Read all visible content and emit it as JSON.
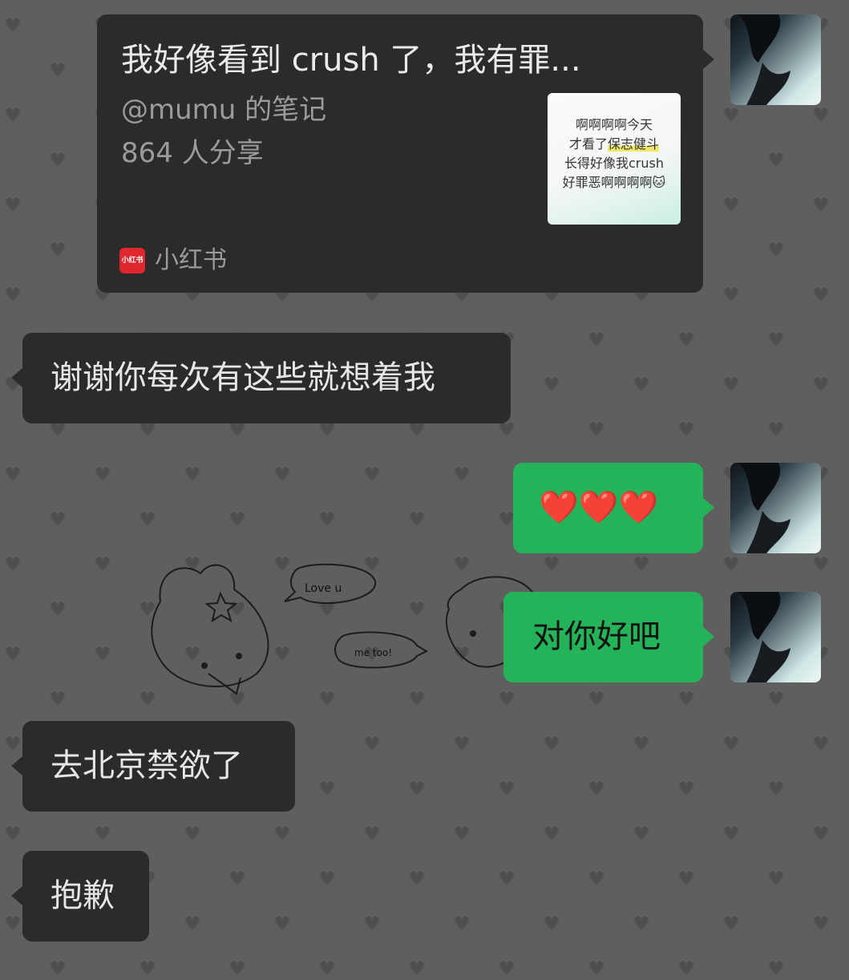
{
  "card": {
    "title": "我好像看到 crush 了，我有罪...",
    "author": "@mumu 的笔记",
    "shares": "864 人分享",
    "thumb_lines": [
      "啊啊啊啊今天",
      "才看了",
      "保志健斗",
      "长得好像我crush",
      "好罪恶啊啊啊啊"
    ],
    "thumb_emoji": "🐱",
    "source_name": "小红书",
    "source_logo": "小红书"
  },
  "messages": [
    {
      "side": "left",
      "text": "谢谢你每次有这些就想着我"
    },
    {
      "side": "right",
      "text": "❤️❤️❤️"
    },
    {
      "side": "right",
      "text": "对你好吧"
    },
    {
      "side": "left",
      "text": "去北京禁欲了"
    },
    {
      "side": "left",
      "text": "抱歉"
    }
  ],
  "doodle": {
    "bubble1": "Love u",
    "bubble2": "me too!"
  },
  "colors": {
    "background": "#5f5f5f",
    "bubble_dark": "#2b2b2b",
    "bubble_green": "#25b35a",
    "heart_pattern": "#4f4f4f"
  }
}
